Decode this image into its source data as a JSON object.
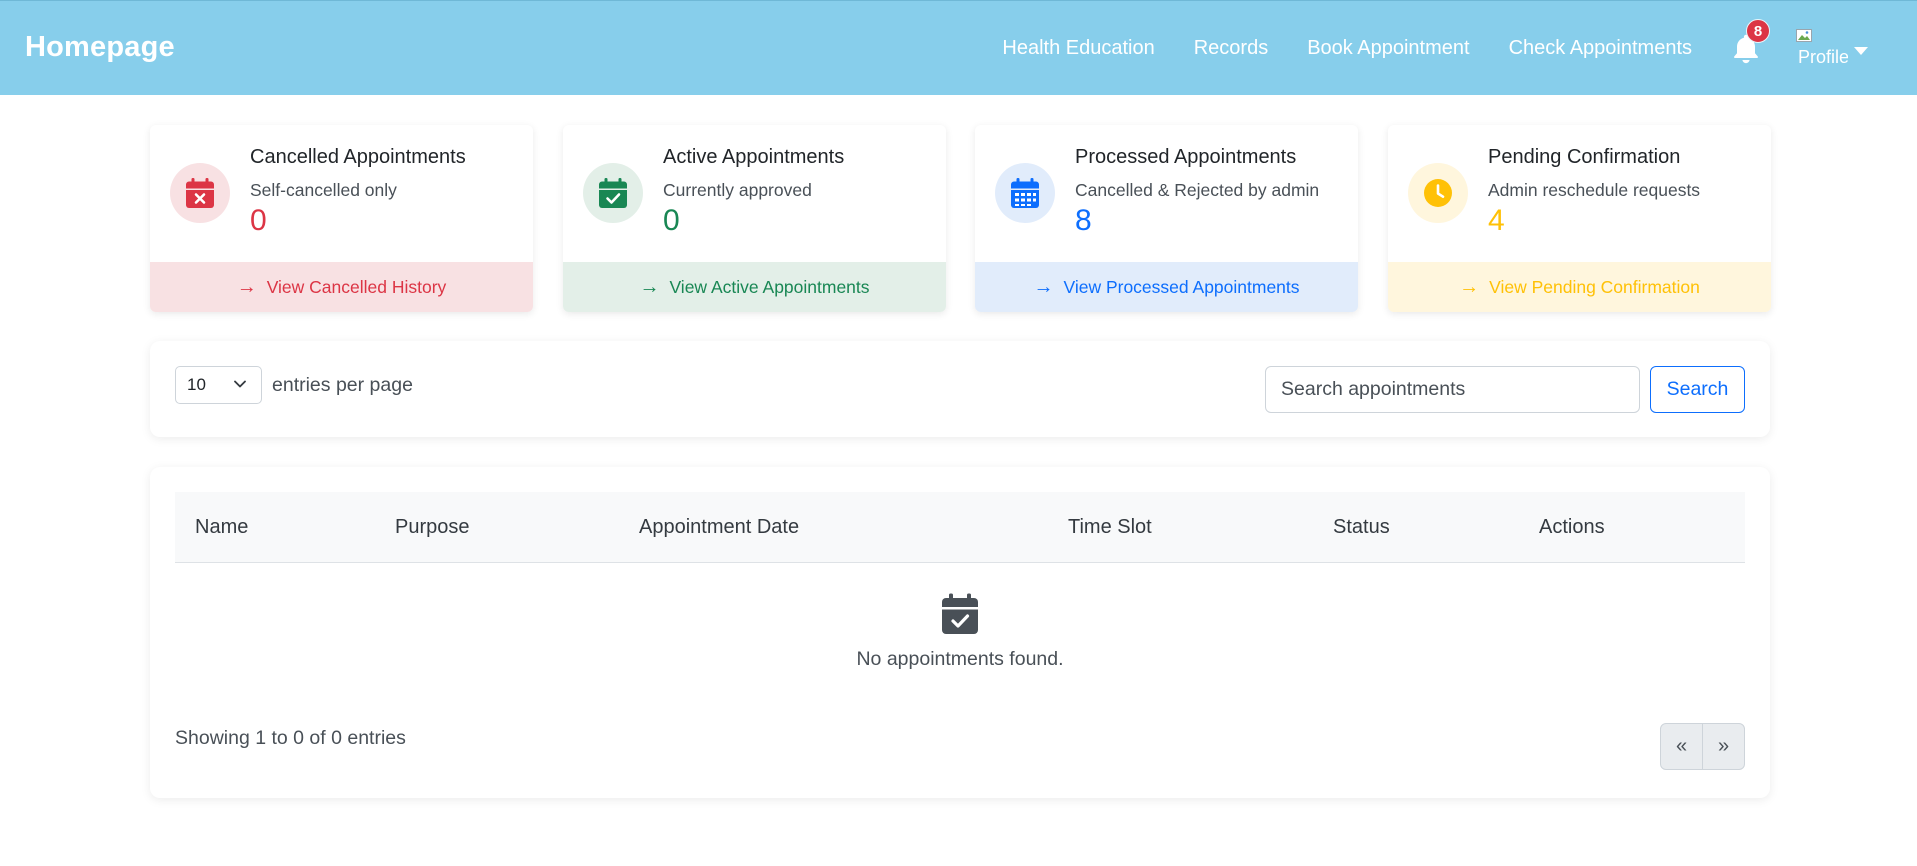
{
  "navbar": {
    "brand": "Homepage",
    "links": [
      "Health Education",
      "Records",
      "Book Appointment",
      "Check Appointments"
    ],
    "notification_count": "8",
    "profile_alt": "Profile"
  },
  "cards": [
    {
      "title": "Cancelled Appointments",
      "subtitle": "Self-cancelled only",
      "count": "0",
      "link": "View Cancelled History",
      "color": "#dc3545",
      "icon_bg": "#f8e1e3",
      "footer_bg": "#f8e1e3",
      "icon": "calendar-x-icon"
    },
    {
      "title": "Active Appointments",
      "subtitle": "Currently approved",
      "count": "0",
      "link": "View Active Appointments",
      "color": "#198754",
      "icon_bg": "#e3efe8",
      "footer_bg": "#e3efe8",
      "icon": "calendar-check-icon"
    },
    {
      "title": "Processed Appointments",
      "subtitle": "Cancelled & Rejected by admin",
      "count": "8",
      "link": "View Processed Appointments",
      "color": "#0d6efd",
      "icon_bg": "#e1ecfb",
      "footer_bg": "#e1ecfb",
      "icon": "calendar-days-icon"
    },
    {
      "title": "Pending Confirmation",
      "subtitle": "Admin reschedule requests",
      "count": "4",
      "link": "View Pending Confirmation",
      "color": "#ffc107",
      "icon_bg": "#fff6dd",
      "footer_bg": "#fff6dd",
      "icon": "clock-icon"
    }
  ],
  "controls": {
    "entries_value": "10",
    "entries_label": "entries per page",
    "search_placeholder": "Search appointments",
    "search_button": "Search"
  },
  "table": {
    "columns": [
      "Name",
      "Purpose",
      "Appointment Date",
      "Time Slot",
      "Status",
      "Actions"
    ],
    "empty_message": "No appointments found.",
    "showing": "Showing 1 to 0 of 0 entries",
    "prev": "«",
    "next": "»"
  }
}
